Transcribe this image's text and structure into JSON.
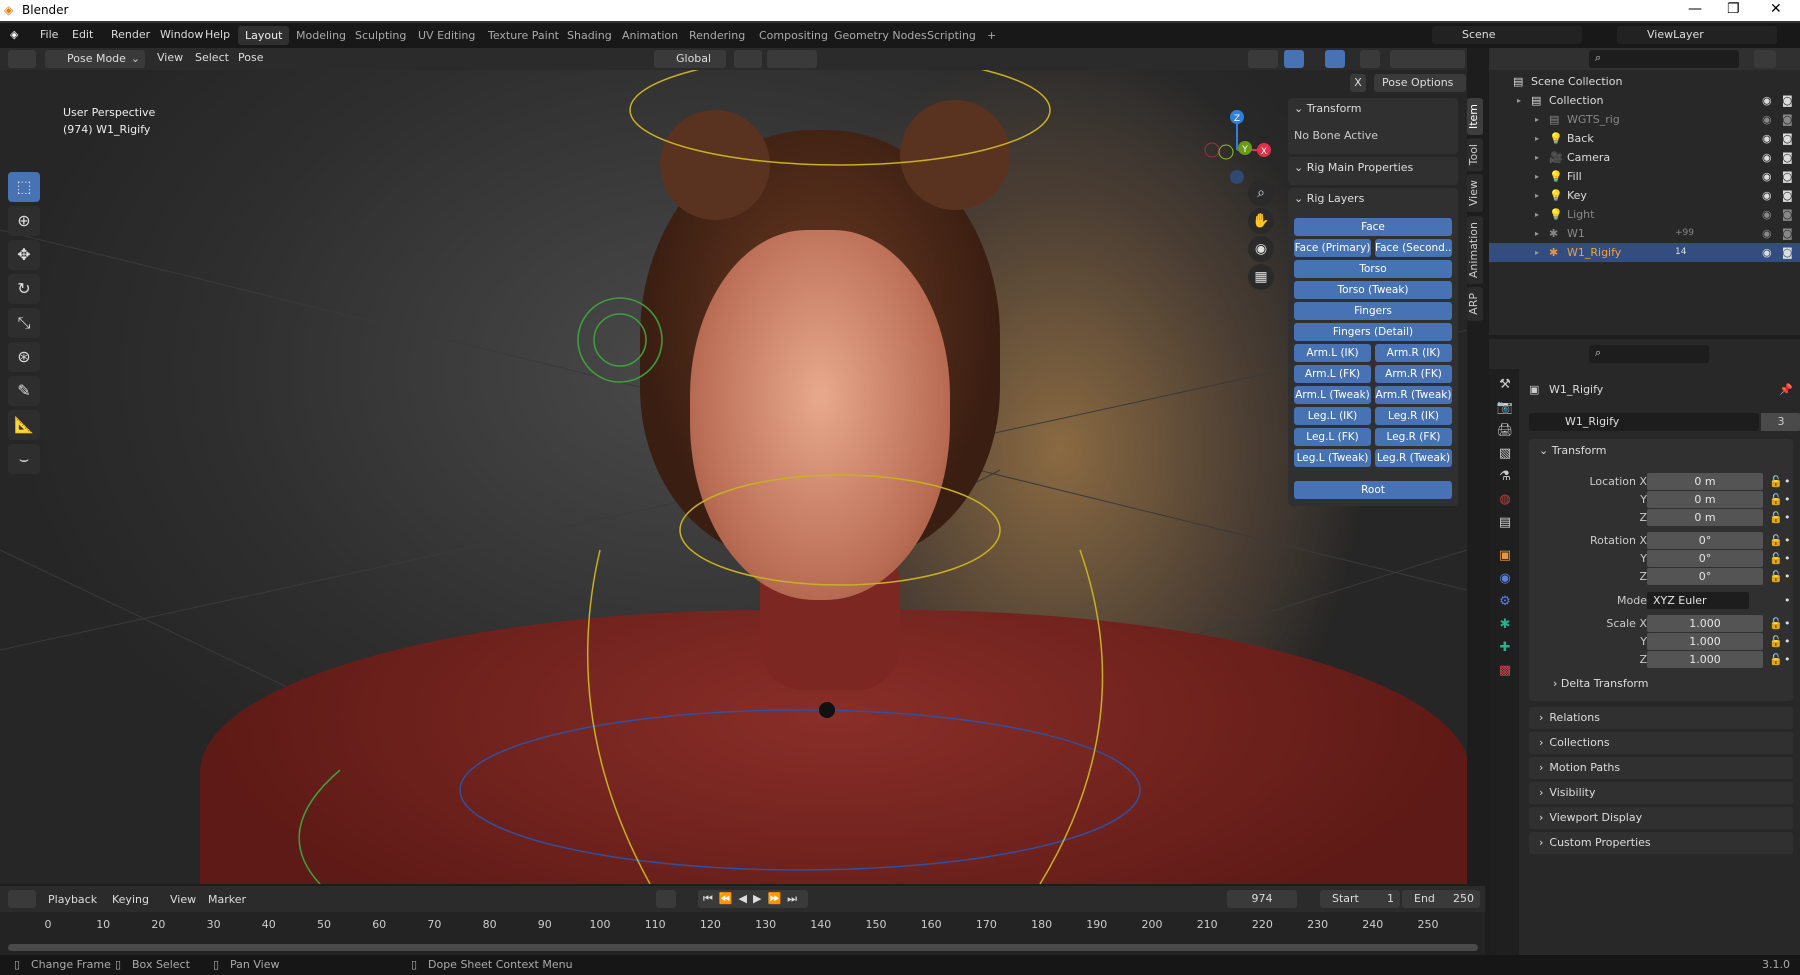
{
  "window": {
    "app_title": "Blender",
    "minimize": "—",
    "restore": "❐",
    "close": "✕"
  },
  "menu": {
    "items": [
      "File",
      "Edit",
      "Render",
      "Window",
      "Help"
    ],
    "workspaces": [
      "Layout",
      "Modeling",
      "Sculpting",
      "UV Editing",
      "Texture Paint",
      "Shading",
      "Animation",
      "Rendering",
      "Compositing",
      "Geometry Nodes",
      "Scripting",
      "+"
    ],
    "active_workspace": "Layout",
    "scene": "Scene",
    "view_layer": "ViewLayer"
  },
  "header": {
    "mode": "Pose Mode",
    "view": "View",
    "select": "Select",
    "pose": "Pose",
    "orientation": "Global",
    "pose_options": "Pose Options",
    "x_mirror": "X"
  },
  "viewport": {
    "perspective": "User Perspective",
    "object_info": "(974) W1_Rigify",
    "gizmo": {
      "z": "Z",
      "y": "Y",
      "x": "X"
    }
  },
  "npanel": {
    "tabs": [
      "Item",
      "Tool",
      "View",
      "Animation",
      "ARP"
    ],
    "transform_title": "Transform",
    "no_bone": "No Bone Active",
    "rig_main": "Rig Main Properties",
    "rig_layers": "Rig Layers",
    "layers": [
      [
        "Face"
      ],
      [
        "Face (Primary)",
        "Face (Second..."
      ],
      [
        "Torso"
      ],
      [
        "Torso (Tweak)"
      ],
      [
        "Fingers"
      ],
      [
        "Fingers (Detail)"
      ],
      [
        "Arm.L (IK)",
        "Arm.R (IK)"
      ],
      [
        "Arm.L (FK)",
        "Arm.R (FK)"
      ],
      [
        "Arm.L (Tweak)",
        "Arm.R (Tweak)"
      ],
      [
        "Leg.L (IK)",
        "Leg.R (IK)"
      ],
      [
        "Leg.L (FK)",
        "Leg.R (FK)"
      ],
      [
        "Leg.L (Tweak)",
        "Leg.R (Tweak)"
      ]
    ],
    "root": "Root",
    "accent": "#4772b3"
  },
  "outliner": {
    "rows": [
      {
        "label": "Scene Collection",
        "indent": 0,
        "icon": "▤",
        "color": "#ddd"
      },
      {
        "label": "Collection",
        "indent": 1,
        "icon": "▤",
        "color": "#ddd"
      },
      {
        "label": "WGTS_rig",
        "indent": 2,
        "icon": "▤",
        "color": "#888",
        "dim": true
      },
      {
        "label": "Back",
        "indent": 2,
        "icon": "💡",
        "color": "#e8953a"
      },
      {
        "label": "Camera",
        "indent": 2,
        "icon": "🎥",
        "color": "#e8953a"
      },
      {
        "label": "Fill",
        "indent": 2,
        "icon": "💡",
        "color": "#e8953a"
      },
      {
        "label": "Key",
        "indent": 2,
        "icon": "💡",
        "color": "#e8953a"
      },
      {
        "label": "Light",
        "indent": 2,
        "icon": "💡",
        "color": "#888",
        "dim": true
      },
      {
        "label": "W1",
        "indent": 2,
        "icon": "✱",
        "color": "#888",
        "dim": true,
        "badge": "+99"
      },
      {
        "label": "W1_Rigify",
        "indent": 2,
        "icon": "✱",
        "color": "#e8953a",
        "selected": true,
        "badge": "14"
      }
    ]
  },
  "properties": {
    "object_name": "W1_Rigify",
    "datablock": "W1_Rigify",
    "users": "3",
    "transform": "Transform",
    "fields": [
      {
        "label": "Location X",
        "value": "0 m"
      },
      {
        "label": "Y",
        "value": "0 m"
      },
      {
        "label": "Z",
        "value": "0 m"
      },
      {
        "label": "Rotation X",
        "value": "0°"
      },
      {
        "label": "Y",
        "value": "0°"
      },
      {
        "label": "Z",
        "value": "0°"
      },
      {
        "label": "Mode",
        "value": "XYZ Euler"
      },
      {
        "label": "Scale X",
        "value": "1.000"
      },
      {
        "label": "Y",
        "value": "1.000"
      },
      {
        "label": "Z",
        "value": "1.000"
      }
    ],
    "delta": "Delta Transform",
    "sections": [
      "Relations",
      "Collections",
      "Motion Paths",
      "Visibility",
      "Viewport Display",
      "Custom Properties"
    ]
  },
  "timeline": {
    "menus": [
      "Playback",
      "Keying",
      "View",
      "Marker"
    ],
    "current_frame": "974",
    "start_label": "Start",
    "start": "1",
    "end_label": "End",
    "end": "250",
    "ticks": [
      "0",
      "10",
      "20",
      "30",
      "40",
      "50",
      "60",
      "70",
      "80",
      "90",
      "100",
      "110",
      "120",
      "130",
      "140",
      "150",
      "160",
      "170",
      "180",
      "190",
      "200",
      "210",
      "220",
      "230",
      "240",
      "250"
    ]
  },
  "status": {
    "items": [
      "Change Frame",
      "Box Select",
      "Pan View",
      "Dope Sheet Context Menu"
    ],
    "version": "3.1.0"
  }
}
